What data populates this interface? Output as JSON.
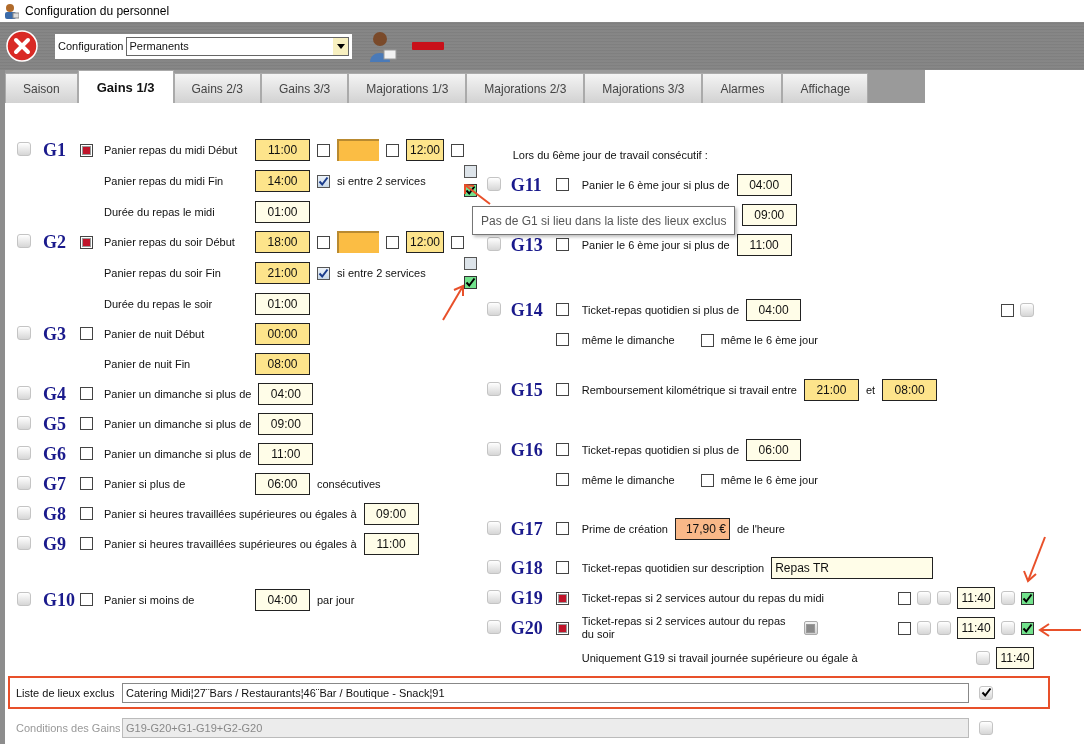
{
  "window": {
    "title": "Configuration du personnel"
  },
  "toolbar": {
    "config_label": "Configuration",
    "config_value": "Permanents"
  },
  "tabs": [
    {
      "label": "Saison",
      "selected": false
    },
    {
      "label": "Gains 1/3",
      "selected": true
    },
    {
      "label": "Gains 2/3",
      "selected": false
    },
    {
      "label": "Gains 3/3",
      "selected": false
    },
    {
      "label": "Majorations 1/3",
      "selected": false
    },
    {
      "label": "Majorations 2/3",
      "selected": false
    },
    {
      "label": "Majorations 3/3",
      "selected": false
    },
    {
      "label": "Alarmes",
      "selected": false
    },
    {
      "label": "Affichage",
      "selected": false
    }
  ],
  "left_groups": [
    {
      "code": "G1",
      "select": false,
      "lines": [
        {
          "lead": {
            "kind": "checkbox",
            "checked": true
          },
          "label": "Panier repas du midi Début",
          "items": [
            {
              "kind": "time",
              "value": "11:00",
              "highlighted": true
            },
            {
              "kind": "checkbox",
              "checked": false
            },
            {
              "kind": "swatch"
            },
            {
              "kind": "checkbox",
              "checked": false
            },
            {
              "kind": "time",
              "value": "12:00",
              "highlighted": true
            },
            {
              "kind": "checkbox",
              "checked": false
            }
          ]
        },
        {
          "label": "Panier repas du midi Fin",
          "items": [
            {
              "kind": "time",
              "value": "14:00",
              "highlighted": true
            },
            {
              "kind": "tickbox",
              "checked": true
            },
            {
              "kind": "text",
              "text": "si entre 2 services"
            },
            {
              "kind": "stack",
              "items": [
                {
                  "kind": "palebox",
                  "checked": false
                },
                {
                  "kind": "greenbox",
                  "checked": true
                }
              ]
            }
          ]
        },
        {
          "label": "Durée du repas le midi",
          "items": [
            {
              "kind": "time",
              "value": "01:00",
              "highlighted": false
            }
          ]
        }
      ]
    },
    {
      "code": "G2",
      "select": false,
      "lines": [
        {
          "lead": {
            "kind": "checkbox",
            "checked": true
          },
          "label": "Panier repas du soir Début",
          "items": [
            {
              "kind": "time",
              "value": "18:00",
              "highlighted": true
            },
            {
              "kind": "checkbox",
              "checked": false
            },
            {
              "kind": "swatch"
            },
            {
              "kind": "checkbox",
              "checked": false
            },
            {
              "kind": "time",
              "value": "12:00",
              "highlighted": true
            },
            {
              "kind": "checkbox",
              "checked": false
            }
          ]
        },
        {
          "label": "Panier repas du soir Fin",
          "items": [
            {
              "kind": "time",
              "value": "21:00",
              "highlighted": true
            },
            {
              "kind": "tickbox",
              "checked": true
            },
            {
              "kind": "text",
              "text": "si entre 2 services"
            },
            {
              "kind": "stack",
              "items": [
                {
                  "kind": "palebox",
                  "checked": false
                },
                {
                  "kind": "greenbox",
                  "checked": true
                }
              ]
            }
          ]
        },
        {
          "label": "Durée du repas le soir",
          "items": [
            {
              "kind": "time",
              "value": "01:00",
              "highlighted": false
            }
          ]
        }
      ]
    },
    {
      "code": "G3",
      "select": false,
      "lines": [
        {
          "lead": {
            "kind": "checkbox",
            "checked": false
          },
          "label": "Panier de nuit Début",
          "items": [
            {
              "kind": "time",
              "value": "00:00",
              "highlighted": true
            }
          ]
        },
        {
          "label": "Panier de nuit Fin",
          "items": [
            {
              "kind": "time",
              "value": "08:00",
              "highlighted": true
            }
          ]
        }
      ]
    },
    {
      "code": "G4",
      "select": false,
      "lines": [
        {
          "lead": {
            "kind": "checkbox",
            "checked": false
          },
          "label": "Panier un dimanche si plus de",
          "items": [
            {
              "kind": "time",
              "value": "04:00",
              "highlighted": false
            }
          ]
        }
      ]
    },
    {
      "code": "G5",
      "select": false,
      "lines": [
        {
          "lead": {
            "kind": "checkbox",
            "checked": false
          },
          "label": "Panier un dimanche si plus de",
          "items": [
            {
              "kind": "time",
              "value": "09:00",
              "highlighted": false
            }
          ]
        }
      ]
    },
    {
      "code": "G6",
      "select": false,
      "lines": [
        {
          "lead": {
            "kind": "checkbox",
            "checked": false
          },
          "label": "Panier un dimanche si plus de",
          "items": [
            {
              "kind": "time",
              "value": "11:00",
              "highlighted": false
            }
          ]
        }
      ]
    },
    {
      "code": "G7",
      "select": false,
      "lines": [
        {
          "lead": {
            "kind": "checkbox",
            "checked": false
          },
          "label": "Panier si plus de",
          "items": [
            {
              "kind": "time",
              "value": "06:00",
              "highlighted": false
            },
            {
              "kind": "text",
              "text": "consécutives"
            }
          ]
        }
      ]
    },
    {
      "code": "G8",
      "select": false,
      "lines": [
        {
          "lead": {
            "kind": "checkbox",
            "checked": false
          },
          "label": "Panier si heures travaillées supérieures ou égales à",
          "items": [
            {
              "kind": "time",
              "value": "09:00",
              "highlighted": false
            }
          ]
        }
      ]
    },
    {
      "code": "G9",
      "select": false,
      "lines": [
        {
          "lead": {
            "kind": "checkbox",
            "checked": false
          },
          "label": "Panier si heures travaillées supérieures ou égales à",
          "items": [
            {
              "kind": "time",
              "value": "11:00",
              "highlighted": false
            }
          ]
        }
      ]
    },
    {
      "code": "G10",
      "select": false,
      "lines": [
        {
          "lead": {
            "kind": "checkbox",
            "checked": false
          },
          "label": "Panier si moins de",
          "items": [
            {
              "kind": "time",
              "value": "04:00",
              "highlighted": false
            },
            {
              "kind": "text",
              "text": "par jour"
            }
          ]
        }
      ]
    }
  ],
  "right_header": "Lors du 6ème jour de travail consécutif :",
  "right_groups": [
    {
      "code": "G11",
      "select": false,
      "lines": [
        {
          "lead": {
            "kind": "checkbox",
            "checked": false
          },
          "label": "Panier le 6 ème jour si plus de",
          "items": [
            {
              "kind": "time",
              "value": "04:00",
              "highlighted": false
            }
          ]
        }
      ]
    },
    {
      "lines": [
        {
          "items": [
            {
              "kind": "time",
              "value": "09:00",
              "highlighted": false
            }
          ]
        }
      ]
    },
    {
      "code": "G13",
      "select": false,
      "lines": [
        {
          "lead": {
            "kind": "checkbox",
            "checked": false
          },
          "label": "Panier le 6 ème jour si plus de",
          "items": [
            {
              "kind": "time",
              "value": "11:00",
              "highlighted": false
            }
          ]
        }
      ]
    },
    {
      "code": "G14",
      "select": false,
      "lines": [
        {
          "lead": {
            "kind": "checkbox",
            "checked": false
          },
          "label": "Ticket-repas quotidien si plus de",
          "items": [
            {
              "kind": "time",
              "value": "04:00",
              "highlighted": false
            }
          ],
          "trailing": [
            {
              "kind": "checkbox",
              "checked": false
            },
            {
              "kind": "graybox",
              "checked": false
            }
          ]
        },
        {
          "lead": {
            "kind": "checkbox",
            "checked": false
          },
          "items": [
            {
              "kind": "text",
              "text": "même le dimanche"
            },
            {
              "kind": "checkbox",
              "checked": false
            },
            {
              "kind": "text",
              "text": "même le 6 ème jour"
            }
          ]
        }
      ]
    },
    {
      "code": "G15",
      "select": false,
      "lines": [
        {
          "lead": {
            "kind": "checkbox",
            "checked": false
          },
          "label": "Remboursement kilométrique si travail entre",
          "items": [
            {
              "kind": "time",
              "value": "21:00",
              "highlighted": true
            },
            {
              "kind": "text",
              "text": "et"
            },
            {
              "kind": "time",
              "value": "08:00",
              "highlighted": true
            }
          ]
        }
      ]
    },
    {
      "code": "G16",
      "select": false,
      "lines": [
        {
          "lead": {
            "kind": "checkbox",
            "checked": false
          },
          "label": "Ticket-repas quotidien si plus de",
          "items": [
            {
              "kind": "time",
              "value": "06:00",
              "highlighted": false
            }
          ]
        },
        {
          "lead": {
            "kind": "checkbox",
            "checked": false
          },
          "items": [
            {
              "kind": "text",
              "text": "même le dimanche"
            },
            {
              "kind": "checkbox",
              "checked": false
            },
            {
              "kind": "text",
              "text": "même le 6 ème jour"
            }
          ]
        }
      ]
    },
    {
      "code": "G17",
      "select": false,
      "lines": [
        {
          "lead": {
            "kind": "checkbox",
            "checked": false
          },
          "label": "Prime de création",
          "items": [
            {
              "kind": "amount",
              "value": "17,90 €"
            },
            {
              "kind": "text",
              "text": "de l'heure"
            }
          ]
        }
      ]
    },
    {
      "code": "G18",
      "select": false,
      "lines": [
        {
          "lead": {
            "kind": "checkbox",
            "checked": false
          },
          "label": "Ticket-repas quotidien sur description",
          "items": [
            {
              "kind": "entry",
              "value": "Repas TR"
            }
          ]
        }
      ]
    },
    {
      "code": "G19",
      "select": false,
      "lines": [
        {
          "lead": {
            "kind": "checkbox",
            "checked": true
          },
          "label": "Ticket-repas si 2 services autour du repas du midi",
          "trailing": [
            {
              "kind": "checkbox",
              "checked": false
            },
            {
              "kind": "graybox",
              "checked": false
            },
            {
              "kind": "graybox",
              "checked": false
            },
            {
              "kind": "time",
              "value": "11:40",
              "highlighted": false
            },
            {
              "kind": "graybox",
              "checked": false
            },
            {
              "kind": "greenbox",
              "checked": true
            }
          ]
        }
      ]
    },
    {
      "code": "G20",
      "select": false,
      "lines": [
        {
          "lead": {
            "kind": "checkbox",
            "checked": true
          },
          "label": "Ticket-repas si 2 services autour du repas du soir",
          "items": [
            {
              "kind": "squarebox",
              "checked": true
            }
          ],
          "trailing": [
            {
              "kind": "checkbox",
              "checked": false
            },
            {
              "kind": "graybox",
              "checked": false
            },
            {
              "kind": "graybox",
              "checked": false
            },
            {
              "kind": "time",
              "value": "11:40",
              "highlighted": false
            },
            {
              "kind": "graybox",
              "checked": false
            },
            {
              "kind": "greenbox",
              "checked": true
            }
          ]
        },
        {
          "label": "Uniquement G19 si travail journée supérieure ou égale à",
          "trailing": [
            {
              "kind": "graybox",
              "checked": false
            },
            {
              "kind": "time",
              "value": "11:40",
              "highlighted": false
            }
          ]
        }
      ]
    }
  ],
  "tooltip": "Pas de G1 si lieu dans la liste des lieux exclus",
  "excluded": {
    "label": "Liste de lieux exclus",
    "value": "Catering Midi¦27¨Bars / Restaurants¦46¨Bar / Boutique - Snack¦91",
    "checked": true
  },
  "conditions": {
    "label": "Conditions des Gains",
    "value": "G19-G20+G1-G19+G2-G20",
    "disabled": true,
    "checked": false
  }
}
